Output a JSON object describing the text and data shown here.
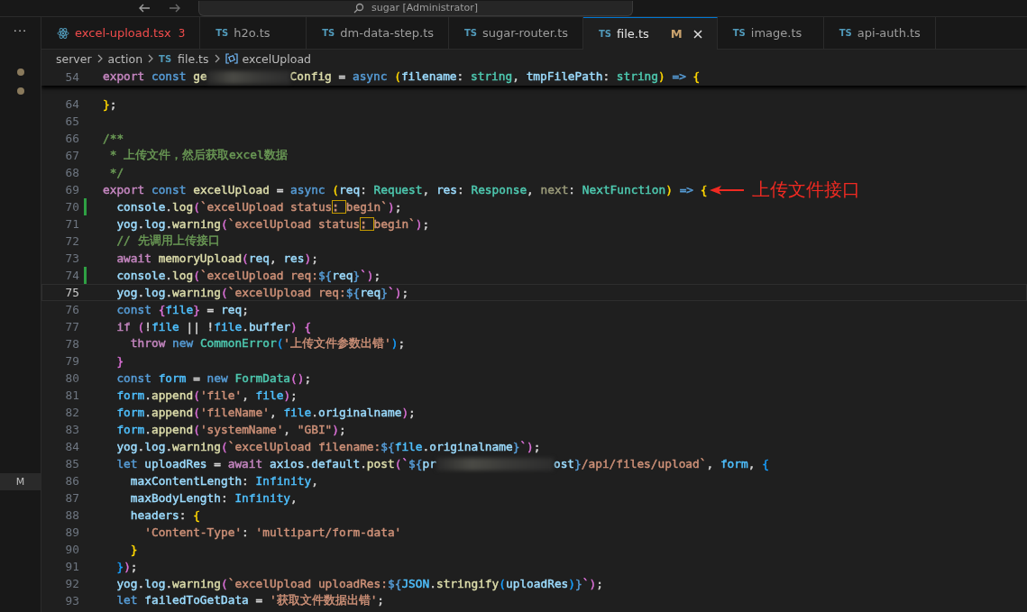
{
  "title_bar": {
    "search": "sugar [Administrator]"
  },
  "activity_bar": {
    "more": "···",
    "badge": "M"
  },
  "tabs": [
    {
      "label": "excel-upload.tsx",
      "kind": "react",
      "errors": "3",
      "selected": false
    },
    {
      "label": "h2o.ts",
      "kind": "ts",
      "icon_label": "TS",
      "selected": false
    },
    {
      "label": "dm-data-step.ts",
      "kind": "ts",
      "icon_label": "TS",
      "selected": false
    },
    {
      "label": "sugar-router.ts",
      "kind": "ts",
      "icon_label": "TS",
      "selected": false
    },
    {
      "label": "file.ts",
      "kind": "ts",
      "icon_label": "TS",
      "status": "M",
      "selected": true
    },
    {
      "label": "image.ts",
      "kind": "ts",
      "icon_label": "TS",
      "selected": false
    },
    {
      "label": "api-auth.ts",
      "kind": "ts",
      "icon_label": "TS",
      "selected": false
    }
  ],
  "breadcrumb": [
    {
      "label": "server",
      "kind": "folder"
    },
    {
      "label": "action",
      "kind": "folder"
    },
    {
      "label": "file.ts",
      "kind": "ts",
      "icon_label": "TS"
    },
    {
      "label": "excelUpload",
      "kind": "symbol"
    }
  ],
  "sticky_line": {
    "number": "54",
    "tokens": [
      {
        "text": "export",
        "color": "#c586c0"
      },
      {
        "text": " const",
        "color": "#569cd6"
      },
      {
        "text": " ge",
        "color": "#dcdcaa"
      },
      {
        "kind": "blur"
      },
      {
        "text": "Config",
        "color": "#dcdcaa"
      },
      {
        "text": " = "
      },
      {
        "text": "async",
        "color": "#569cd6"
      },
      {
        "text": " (",
        "color": "#ffd700"
      },
      {
        "text": "filename",
        "color": "#9cdcfe"
      },
      {
        "text": ": "
      },
      {
        "text": "string",
        "color": "#4ec9b0"
      },
      {
        "text": ", "
      },
      {
        "text": "tmpFilePath",
        "color": "#9cdcfe"
      },
      {
        "text": ": "
      },
      {
        "text": "string",
        "color": "#4ec9b0"
      },
      {
        "text": ")",
        "color": "#ffd700"
      },
      {
        "text": " =>",
        "color": "#569cd6"
      },
      {
        "text": " {",
        "color": "#ffd700"
      }
    ]
  },
  "lines": [
    {
      "number": "64",
      "tokens": [
        {
          "text": "}",
          "color": "#ffd700"
        },
        {
          "text": ";"
        }
      ]
    },
    {
      "number": "65"
    },
    {
      "number": "66",
      "tokens": [
        {
          "text": "/**",
          "color": "#6a9955"
        }
      ]
    },
    {
      "number": "67",
      "tokens": [
        {
          "text": " * 上传文件，然后获取excel数据",
          "color": "#6a9955"
        }
      ]
    },
    {
      "number": "68",
      "tokens": [
        {
          "text": " */",
          "color": "#6a9955"
        }
      ]
    },
    {
      "number": "69",
      "tokens": [
        {
          "text": "export",
          "color": "#c586c0"
        },
        {
          "text": " const",
          "color": "#569cd6"
        },
        {
          "text": " excelUpload",
          "color": "#dcdcaa"
        },
        {
          "text": " = "
        },
        {
          "text": "async",
          "color": "#569cd6"
        },
        {
          "text": " (",
          "color": "#ffd700"
        },
        {
          "text": "req",
          "color": "#9cdcfe"
        },
        {
          "text": ": "
        },
        {
          "text": "Request",
          "color": "#4ec9b0"
        },
        {
          "text": ", "
        },
        {
          "text": "res",
          "color": "#9cdcfe"
        },
        {
          "text": ": "
        },
        {
          "text": "Response",
          "color": "#4ec9b0"
        },
        {
          "text": ", "
        },
        {
          "text": "next",
          "color": "#9b9b7a"
        },
        {
          "text": ": "
        },
        {
          "text": "NextFunction",
          "color": "#4ec9b0"
        },
        {
          "text": ")",
          "color": "#ffd700"
        },
        {
          "text": " =>",
          "color": "#569cd6"
        },
        {
          "text": " {",
          "color": "#ffd700"
        }
      ],
      "annotation": "上传文件接口"
    },
    {
      "number": "70",
      "added": true,
      "tokens": [
        {
          "text": "  console",
          "color": "#9cdcfe"
        },
        {
          "text": "."
        },
        {
          "text": "log",
          "color": "#dcdcaa"
        },
        {
          "text": "(",
          "color": "#da70d6"
        },
        {
          "text": "`excelUpload status",
          "color": "#ce9178"
        },
        {
          "text": ": ",
          "color": "#ce9178",
          "boxed": true
        },
        {
          "text": "begin`",
          "color": "#ce9178"
        },
        {
          "text": ")",
          "color": "#da70d6"
        },
        {
          "text": ";"
        }
      ]
    },
    {
      "number": "71",
      "tokens": [
        {
          "text": "  yog",
          "color": "#9cdcfe"
        },
        {
          "text": "."
        },
        {
          "text": "log",
          "color": "#9cdcfe"
        },
        {
          "text": "."
        },
        {
          "text": "warning",
          "color": "#dcdcaa"
        },
        {
          "text": "(",
          "color": "#da70d6"
        },
        {
          "text": "`excelUpload status",
          "color": "#ce9178"
        },
        {
          "text": ": ",
          "color": "#ce9178",
          "boxed": true
        },
        {
          "text": "begin`",
          "color": "#ce9178"
        },
        {
          "text": ")",
          "color": "#da70d6"
        },
        {
          "text": ";"
        }
      ]
    },
    {
      "number": "72",
      "tokens": [
        {
          "text": "  // 先调用上传接口",
          "color": "#6a9955"
        }
      ]
    },
    {
      "number": "73",
      "tokens": [
        {
          "text": "  await",
          "color": "#c586c0"
        },
        {
          "text": " memoryUpload",
          "color": "#dcdcaa"
        },
        {
          "text": "(",
          "color": "#da70d6"
        },
        {
          "text": "req",
          "color": "#9cdcfe"
        },
        {
          "text": ", "
        },
        {
          "text": "res",
          "color": "#9cdcfe"
        },
        {
          "text": ")",
          "color": "#da70d6"
        },
        {
          "text": ";"
        }
      ]
    },
    {
      "number": "74",
      "added": true,
      "tokens": [
        {
          "text": "  console",
          "color": "#9cdcfe"
        },
        {
          "text": "."
        },
        {
          "text": "log",
          "color": "#dcdcaa"
        },
        {
          "text": "(",
          "color": "#da70d6"
        },
        {
          "text": "`excelUpload req:",
          "color": "#ce9178"
        },
        {
          "text": "${",
          "color": "#569cd6"
        },
        {
          "text": "req",
          "color": "#9cdcfe"
        },
        {
          "text": "}",
          "color": "#569cd6"
        },
        {
          "text": "`)",
          "color": "#da70d6"
        },
        {
          "text": ";"
        }
      ]
    },
    {
      "number": "75",
      "current": true,
      "tokens": [
        {
          "text": "  yog",
          "color": "#9cdcfe"
        },
        {
          "text": "."
        },
        {
          "text": "log",
          "color": "#9cdcfe"
        },
        {
          "text": "."
        },
        {
          "text": "warning",
          "color": "#dcdcaa"
        },
        {
          "text": "(",
          "color": "#da70d6"
        },
        {
          "text": "`excelUpload req:",
          "color": "#ce9178"
        },
        {
          "text": "${",
          "color": "#569cd6"
        },
        {
          "text": "req",
          "color": "#9cdcfe"
        },
        {
          "text": "}",
          "color": "#569cd6"
        },
        {
          "text": "`)",
          "color": "#da70d6"
        },
        {
          "text": ";"
        }
      ]
    },
    {
      "number": "76",
      "tokens": [
        {
          "text": "  const",
          "color": "#569cd6"
        },
        {
          "text": " {",
          "color": "#da70d6"
        },
        {
          "text": "file",
          "color": "#4fc1ff"
        },
        {
          "text": "}",
          "color": "#da70d6"
        },
        {
          "text": " = "
        },
        {
          "text": "req",
          "color": "#9cdcfe"
        },
        {
          "text": ";"
        }
      ]
    },
    {
      "number": "77",
      "tokens": [
        {
          "text": "  if",
          "color": "#c586c0"
        },
        {
          "text": " (",
          "color": "#da70d6"
        },
        {
          "text": "!"
        },
        {
          "text": "file",
          "color": "#4fc1ff"
        },
        {
          "text": " || !"
        },
        {
          "text": "file",
          "color": "#4fc1ff"
        },
        {
          "text": "."
        },
        {
          "text": "buffer",
          "color": "#9cdcfe"
        },
        {
          "text": ")",
          "color": "#da70d6"
        },
        {
          "text": " {",
          "color": "#da70d6"
        }
      ]
    },
    {
      "number": "78",
      "tokens": [
        {
          "text": "    throw",
          "color": "#c586c0"
        },
        {
          "text": " new",
          "color": "#569cd6"
        },
        {
          "text": " CommonError",
          "color": "#4ec9b0"
        },
        {
          "text": "(",
          "color": "#179fff"
        },
        {
          "text": "'上传文件参数出错'",
          "color": "#ce9178"
        },
        {
          "text": ")",
          "color": "#179fff"
        },
        {
          "text": ";"
        }
      ]
    },
    {
      "number": "79",
      "tokens": [
        {
          "text": "  }",
          "color": "#da70d6"
        }
      ]
    },
    {
      "number": "80",
      "tokens": [
        {
          "text": "  const",
          "color": "#569cd6"
        },
        {
          "text": " form",
          "color": "#4fc1ff"
        },
        {
          "text": " = "
        },
        {
          "text": "new",
          "color": "#569cd6"
        },
        {
          "text": " FormData",
          "color": "#4ec9b0"
        },
        {
          "text": "(",
          "color": "#da70d6"
        },
        {
          "text": ")",
          "color": "#da70d6"
        },
        {
          "text": ";"
        }
      ]
    },
    {
      "number": "81",
      "tokens": [
        {
          "text": "  form",
          "color": "#4fc1ff"
        },
        {
          "text": "."
        },
        {
          "text": "append",
          "color": "#dcdcaa"
        },
        {
          "text": "(",
          "color": "#da70d6"
        },
        {
          "text": "'file'",
          "color": "#ce9178"
        },
        {
          "text": ", "
        },
        {
          "text": "file",
          "color": "#4fc1ff"
        },
        {
          "text": ")",
          "color": "#da70d6"
        },
        {
          "text": ";"
        }
      ]
    },
    {
      "number": "82",
      "tokens": [
        {
          "text": "  form",
          "color": "#4fc1ff"
        },
        {
          "text": "."
        },
        {
          "text": "append",
          "color": "#dcdcaa"
        },
        {
          "text": "(",
          "color": "#da70d6"
        },
        {
          "text": "'fileName'",
          "color": "#ce9178"
        },
        {
          "text": ", "
        },
        {
          "text": "file",
          "color": "#4fc1ff"
        },
        {
          "text": "."
        },
        {
          "text": "originalname",
          "color": "#9cdcfe"
        },
        {
          "text": ")",
          "color": "#da70d6"
        },
        {
          "text": ";"
        }
      ]
    },
    {
      "number": "83",
      "tokens": [
        {
          "text": "  form",
          "color": "#4fc1ff"
        },
        {
          "text": "."
        },
        {
          "text": "append",
          "color": "#dcdcaa"
        },
        {
          "text": "(",
          "color": "#da70d6"
        },
        {
          "text": "'systemName'",
          "color": "#ce9178"
        },
        {
          "text": ", "
        },
        {
          "text": "\"GBI\"",
          "color": "#ce9178"
        },
        {
          "text": ")",
          "color": "#da70d6"
        },
        {
          "text": ";"
        }
      ]
    },
    {
      "number": "84",
      "tokens": [
        {
          "text": "  yog",
          "color": "#9cdcfe"
        },
        {
          "text": "."
        },
        {
          "text": "log",
          "color": "#9cdcfe"
        },
        {
          "text": "."
        },
        {
          "text": "warning",
          "color": "#dcdcaa"
        },
        {
          "text": "(",
          "color": "#da70d6"
        },
        {
          "text": "`excelUpload filename:",
          "color": "#ce9178"
        },
        {
          "text": "${",
          "color": "#569cd6"
        },
        {
          "text": "file",
          "color": "#4fc1ff"
        },
        {
          "text": "."
        },
        {
          "text": "originalname",
          "color": "#9cdcfe"
        },
        {
          "text": "}",
          "color": "#569cd6"
        },
        {
          "text": "`)",
          "color": "#da70d6"
        },
        {
          "text": ";"
        }
      ]
    },
    {
      "number": "85",
      "tokens": [
        {
          "text": "  let",
          "color": "#569cd6"
        },
        {
          "text": " uploadRes",
          "color": "#9cdcfe"
        },
        {
          "text": " = "
        },
        {
          "text": "await",
          "color": "#c586c0"
        },
        {
          "text": " axios",
          "color": "#9cdcfe"
        },
        {
          "text": "."
        },
        {
          "text": "default",
          "color": "#9cdcfe"
        },
        {
          "text": "."
        },
        {
          "text": "post",
          "color": "#dcdcaa"
        },
        {
          "text": "(`",
          "color": "#da70d6"
        },
        {
          "text": "${",
          "color": "#569cd6"
        },
        {
          "text": "pr",
          "color": "#9cdcfe"
        },
        {
          "kind": "blur"
        },
        {
          "text": "ost",
          "color": "#9cdcfe"
        },
        {
          "text": "}",
          "color": "#569cd6"
        },
        {
          "text": "/api/files/upload`",
          "color": "#ce9178"
        },
        {
          "text": ", "
        },
        {
          "text": "form",
          "color": "#4fc1ff"
        },
        {
          "text": ", "
        },
        {
          "text": "{",
          "color": "#179fff"
        }
      ]
    },
    {
      "number": "86",
      "tokens": [
        {
          "text": "    maxContentLength",
          "color": "#9cdcfe"
        },
        {
          "text": ": "
        },
        {
          "text": "Infinity",
          "color": "#4fc1ff"
        },
        {
          "text": ","
        }
      ]
    },
    {
      "number": "87",
      "tokens": [
        {
          "text": "    maxBodyLength",
          "color": "#9cdcfe"
        },
        {
          "text": ": "
        },
        {
          "text": "Infinity",
          "color": "#4fc1ff"
        },
        {
          "text": ","
        }
      ]
    },
    {
      "number": "88",
      "tokens": [
        {
          "text": "    headers",
          "color": "#9cdcfe"
        },
        {
          "text": ": "
        },
        {
          "text": "{",
          "color": "#ffd700"
        }
      ]
    },
    {
      "number": "89",
      "tokens": [
        {
          "text": "      'Content-Type'",
          "color": "#ce9178"
        },
        {
          "text": ": "
        },
        {
          "text": "'multipart/form-data'",
          "color": "#ce9178"
        }
      ]
    },
    {
      "number": "90",
      "tokens": [
        {
          "text": "    }",
          "color": "#ffd700"
        }
      ]
    },
    {
      "number": "91",
      "tokens": [
        {
          "text": "  }",
          "color": "#179fff"
        },
        {
          "text": ")",
          "color": "#da70d6"
        },
        {
          "text": ";"
        }
      ]
    },
    {
      "number": "92",
      "tokens": [
        {
          "text": "  yog",
          "color": "#9cdcfe"
        },
        {
          "text": "."
        },
        {
          "text": "log",
          "color": "#9cdcfe"
        },
        {
          "text": "."
        },
        {
          "text": "warning",
          "color": "#dcdcaa"
        },
        {
          "text": "(",
          "color": "#da70d6"
        },
        {
          "text": "`excelUpload uploadRes:",
          "color": "#ce9178"
        },
        {
          "text": "${",
          "color": "#569cd6"
        },
        {
          "text": "JSON",
          "color": "#4fc1ff"
        },
        {
          "text": "."
        },
        {
          "text": "stringify",
          "color": "#dcdcaa"
        },
        {
          "text": "(",
          "color": "#179fff"
        },
        {
          "text": "uploadRes",
          "color": "#9cdcfe"
        },
        {
          "text": ")",
          "color": "#179fff"
        },
        {
          "text": "}",
          "color": "#569cd6"
        },
        {
          "text": "`)",
          "color": "#da70d6"
        },
        {
          "text": ";"
        }
      ]
    },
    {
      "number": "93",
      "tokens": [
        {
          "text": "  let",
          "color": "#569cd6"
        },
        {
          "text": " failedToGetData",
          "color": "#9cdcfe"
        },
        {
          "text": " = "
        },
        {
          "text": "'获取文件数据出错'",
          "color": "#ce9178"
        },
        {
          "text": ";"
        }
      ]
    }
  ]
}
